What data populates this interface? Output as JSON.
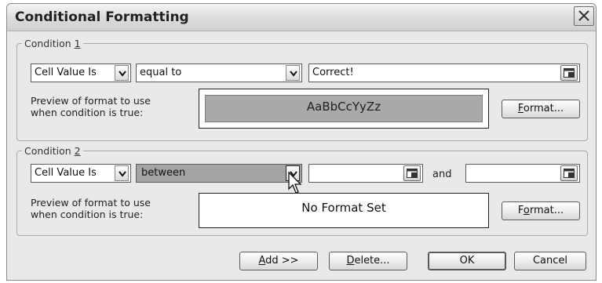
{
  "window": {
    "title": "Conditional Formatting"
  },
  "conditions": [
    {
      "legend_prefix": "Condition ",
      "legend_number": "1",
      "type_value": "Cell Value Is",
      "operator_value": "equal to",
      "value1": "Correct!",
      "preview_label_line1": "Preview of format to use",
      "preview_label_line2": "when condition is true:",
      "preview_text": "AaBbCcYyZz",
      "format_button_accel": "F",
      "format_button_rest": "ormat..."
    },
    {
      "legend_prefix": "Condition ",
      "legend_number": "2",
      "type_value": "Cell Value Is",
      "operator_value": "between",
      "value1": "",
      "and_label": "and",
      "value2": "",
      "preview_label_line1": "Preview of format to use",
      "preview_label_line2": "when condition is true:",
      "preview_text": "No Format Set",
      "format_button_pre": "F",
      "format_button_accel": "o",
      "format_button_rest": "rmat..."
    }
  ],
  "buttons": {
    "add_accel": "A",
    "add_rest": "dd >>",
    "delete_accel": "D",
    "delete_rest": "elete...",
    "ok": "OK",
    "cancel": "Cancel"
  },
  "colors": {
    "dialog_bg": "#e9e9e9",
    "preview_fill": "#a9a9a9",
    "selection_fill": "#a4a4a4"
  },
  "icons": {
    "close": "close-icon",
    "dropdown": "chevron-down-icon",
    "range_select": "collapse-dialog-icon",
    "pointer": "mouse-cursor-icon"
  }
}
